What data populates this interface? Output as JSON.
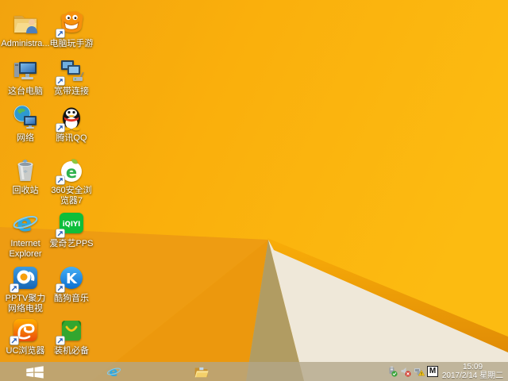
{
  "wallpaper": {
    "colors": {
      "base_left": "#F2A30E",
      "base_mid": "#FAAF0C",
      "base_right": "#FCBB11",
      "fold_left": "#EE9C12",
      "fold_dark": "#EC980D",
      "khaki_triangle": "#B19C62",
      "cream_panel": "#EFE8D9",
      "ridge_top": "#F9AD08",
      "ridge_bottom": "#E08C06"
    }
  },
  "brand": {
    "ie_e": "e",
    "e360": "e",
    "iqiyi": "iQIYI",
    "kugou": "K"
  },
  "desktop": {
    "icons": [
      {
        "id": "administrator-folder",
        "kind": "folder-user",
        "label": "Administra...",
        "col": 0,
        "row": 0,
        "shortcut": false
      },
      {
        "id": "mobile-game-emulator",
        "kind": "monster",
        "label": "电脑玩手游",
        "col": 1,
        "row": 0,
        "shortcut": true
      },
      {
        "id": "this-pc",
        "kind": "pc",
        "label": "这台电脑",
        "col": 0,
        "row": 1,
        "shortcut": false
      },
      {
        "id": "broadband-connection",
        "kind": "broadband",
        "label": "宽带连接",
        "col": 1,
        "row": 1,
        "shortcut": true
      },
      {
        "id": "network",
        "kind": "network",
        "label": "网络",
        "col": 0,
        "row": 2,
        "shortcut": false
      },
      {
        "id": "tencent-qq",
        "kind": "qq",
        "label": "腾讯QQ",
        "col": 1,
        "row": 2,
        "shortcut": true
      },
      {
        "id": "recycle-bin",
        "kind": "recycle",
        "label": "回收站",
        "col": 0,
        "row": 3,
        "shortcut": false
      },
      {
        "id": "360-safe-browser",
        "kind": "browser360",
        "label": "360安全浏览器7",
        "col": 1,
        "row": 3,
        "shortcut": true
      },
      {
        "id": "internet-explorer",
        "kind": "ie",
        "label": "Internet Explorer",
        "col": 0,
        "row": 4,
        "shortcut": false
      },
      {
        "id": "iqiyi-pps",
        "kind": "iqiyi",
        "label": "爱奇艺PPS",
        "col": 1,
        "row": 4,
        "shortcut": true
      },
      {
        "id": "pptv",
        "kind": "pptv",
        "label": "PPTV聚力 网络电视",
        "col": 0,
        "row": 5,
        "shortcut": true
      },
      {
        "id": "kugou-music",
        "kind": "kugou",
        "label": "酷狗音乐",
        "col": 1,
        "row": 5,
        "shortcut": true
      },
      {
        "id": "uc-browser",
        "kind": "uc",
        "label": "UC浏览器",
        "col": 0,
        "row": 6,
        "shortcut": true
      },
      {
        "id": "essential-apps",
        "kind": "bag",
        "label": "装机必备",
        "col": 1,
        "row": 6,
        "shortcut": true
      }
    ]
  },
  "taskbar": {
    "start": {
      "icon": "windows-logo"
    },
    "pinned": [
      {
        "id": "internet-explorer",
        "kind": "ie",
        "icon": "ie-icon"
      },
      {
        "id": "file-explorer",
        "kind": "explorer",
        "icon": "folder-icon"
      }
    ],
    "tray": [
      {
        "id": "hardware-safe-remove",
        "kind": "usb-check",
        "icon": "usb-check-icon"
      },
      {
        "id": "volume-muted",
        "kind": "volume-x",
        "icon": "speaker-muted-icon"
      },
      {
        "id": "network-warning",
        "kind": "net-warn",
        "icon": "network-warning-icon"
      },
      {
        "id": "input-method",
        "kind": "ime",
        "label": "M",
        "icon": "ime-m-icon"
      }
    ],
    "clock": {
      "time": "15:09",
      "date": "2017/2/14 星期二"
    }
  }
}
